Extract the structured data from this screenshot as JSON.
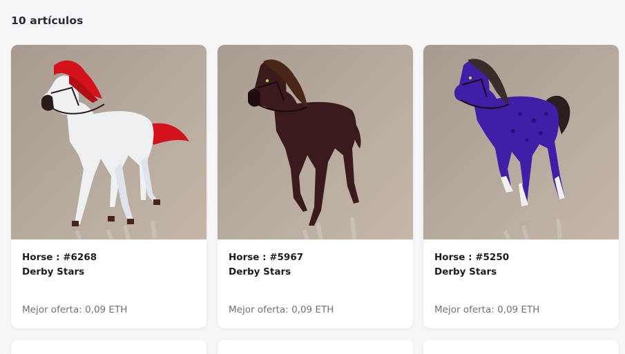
{
  "results": {
    "count_label": "10 artículos"
  },
  "items": [
    {
      "title": "Horse : #6268",
      "collection": "Derby Stars",
      "offer": "Mejor oferta: 0,09 ETH",
      "image": "white-horse-red-mane",
      "body_color": "#eef0f2",
      "mane_color": "#d3121a"
    },
    {
      "title": "Horse : #5967",
      "collection": "Derby Stars",
      "offer": "Mejor oferta: 0,09 ETH",
      "image": "dark-brown-horse",
      "body_color": "#3a1a1d",
      "mane_color": "#4a2618"
    },
    {
      "title": "Horse : #5250",
      "collection": "Derby Stars",
      "offer": "Mejor oferta: 0,09 ETH",
      "image": "purple-spotted-horse",
      "body_color": "#3f1ea8",
      "mane_color": "#3b2b2b"
    }
  ],
  "colors": {
    "page_background": "#f6f6f8",
    "card_background": "#ffffff",
    "image_background": "#b7aa9e",
    "muted_text": "#6f6f7b"
  }
}
